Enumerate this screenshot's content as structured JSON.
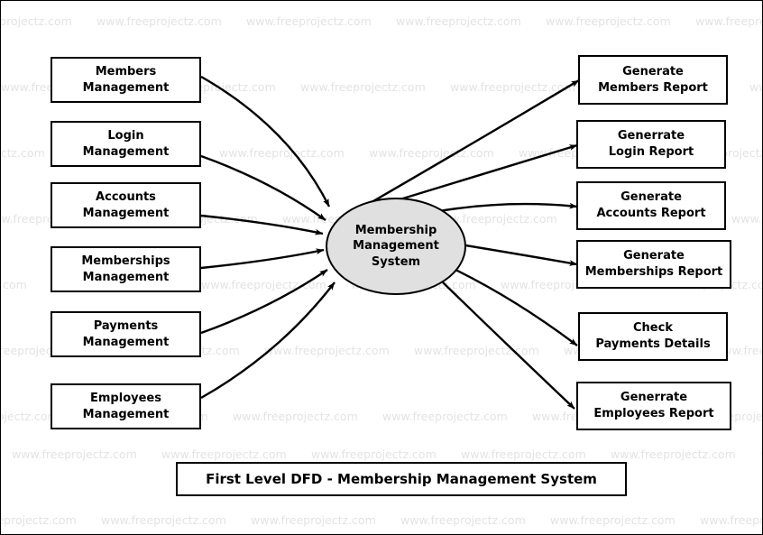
{
  "diagram": {
    "title": "First Level DFD - Membership Management System",
    "process": {
      "label": "Membership\nManagement\nSystem",
      "line1": "Membership",
      "line2": "Management",
      "line3": "System",
      "fill": "#e0e0e0",
      "stroke": "#000000"
    },
    "inputs": [
      {
        "id": "members-management",
        "line1": "Members",
        "line2": "Management"
      },
      {
        "id": "login-management",
        "line1": "Login",
        "line2": "Management"
      },
      {
        "id": "accounts-management",
        "line1": "Accounts",
        "line2": "Management"
      },
      {
        "id": "memberships-management",
        "line1": "Memberships",
        "line2": "Management"
      },
      {
        "id": "payments-management",
        "line1": "Payments",
        "line2": "Management"
      },
      {
        "id": "employees-management",
        "line1": "Employees",
        "line2": "Management"
      }
    ],
    "outputs": [
      {
        "id": "generate-members-report",
        "line1": "Generate",
        "line2": "Members Report"
      },
      {
        "id": "generrate-login-report",
        "line1": "Generrate",
        "line2": "Login Report"
      },
      {
        "id": "generate-accounts-report",
        "line1": "Generate",
        "line2": "Accounts Report"
      },
      {
        "id": "generate-memberships-report",
        "line1": "Generate",
        "line2": "Memberships Report"
      },
      {
        "id": "check-payments-details",
        "line1": "Check",
        "line2": "Payments Details"
      },
      {
        "id": "generrate-employees-report",
        "line1": "Generrate",
        "line2": "Employees Report"
      }
    ]
  },
  "watermark": {
    "text": "www.freeprojectz.com",
    "color": "#e3e3e3"
  }
}
